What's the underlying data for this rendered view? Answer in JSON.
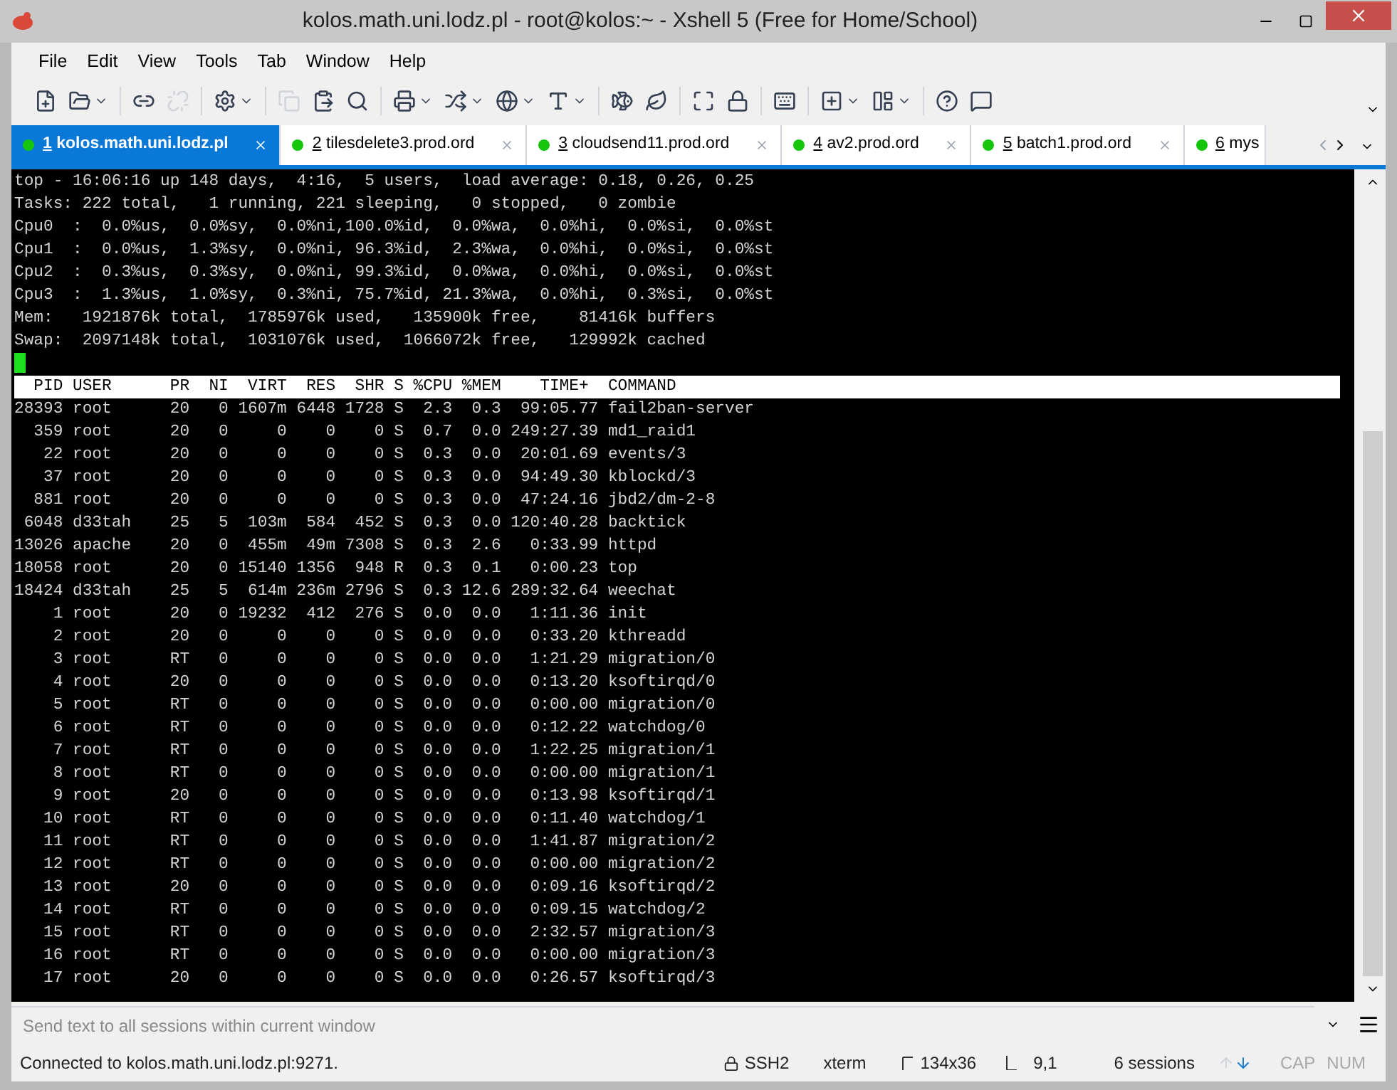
{
  "window": {
    "title": "kolos.math.uni.lodz.pl - root@kolos:~ - Xshell 5 (Free for Home/School)"
  },
  "menu": [
    "File",
    "Edit",
    "View",
    "Tools",
    "Tab",
    "Window",
    "Help"
  ],
  "tabs": [
    {
      "number": "1",
      "label": " kolos.math.uni.lodz.pl",
      "selected": true,
      "closable": true
    },
    {
      "number": "2",
      "label": " tilesdelete3.prod.ord",
      "selected": false,
      "closable": true
    },
    {
      "number": "3",
      "label": " cloudsend11.prod.ord",
      "selected": false,
      "closable": true
    },
    {
      "number": "4",
      "label": " av2.prod.ord",
      "selected": false,
      "closable": true
    },
    {
      "number": "5",
      "label": " batch1.prod.ord",
      "selected": false,
      "closable": true
    },
    {
      "number": "6",
      "label": " mys",
      "selected": false,
      "closable": false
    }
  ],
  "terminal": {
    "summary_lines": [
      "top - 16:06:16 up 148 days,  4:16,  5 users,  load average: 0.18, 0.26, 0.25",
      "Tasks: 222 total,   1 running, 221 sleeping,   0 stopped,   0 zombie",
      "Cpu0  :  0.0%us,  0.0%sy,  0.0%ni,100.0%id,  0.0%wa,  0.0%hi,  0.0%si,  0.0%st",
      "Cpu1  :  0.0%us,  1.3%sy,  0.0%ni, 96.3%id,  2.3%wa,  0.0%hi,  0.0%si,  0.0%st",
      "Cpu2  :  0.3%us,  0.3%sy,  0.0%ni, 99.3%id,  0.0%wa,  0.0%hi,  0.0%si,  0.0%st",
      "Cpu3  :  1.3%us,  1.0%sy,  0.3%ni, 75.7%id, 21.3%wa,  0.0%hi,  0.3%si,  0.0%st",
      "Mem:   1921876k total,  1785976k used,   135900k free,    81416k buffers",
      "Swap:  2097148k total,  1031076k used,  1066072k free,   129992k cached"
    ],
    "table_header": "  PID USER      PR  NI  VIRT  RES  SHR S %CPU %MEM    TIME+  COMMAND",
    "rows": [
      "28393 root      20   0 1607m 6448 1728 S  2.3  0.3  99:05.77 fail2ban-server",
      "  359 root      20   0     0    0    0 S  0.7  0.0 249:27.39 md1_raid1",
      "   22 root      20   0     0    0    0 S  0.3  0.0  20:01.69 events/3",
      "   37 root      20   0     0    0    0 S  0.3  0.0  94:49.30 kblockd/3",
      "  881 root      20   0     0    0    0 S  0.3  0.0  47:24.16 jbd2/dm-2-8",
      " 6048 d33tah    25   5  103m  584  452 S  0.3  0.0 120:40.28 backtick",
      "13026 apache    20   0  455m  49m 7308 S  0.3  2.6   0:33.99 httpd",
      "18058 root      20   0 15140 1356  948 R  0.3  0.1   0:00.23 top",
      "18424 d33tah    25   5  614m 236m 2796 S  0.3 12.6 289:32.64 weechat",
      "    1 root      20   0 19232  412  276 S  0.0  0.0   1:11.36 init",
      "    2 root      20   0     0    0    0 S  0.0  0.0   0:33.20 kthreadd",
      "    3 root      RT   0     0    0    0 S  0.0  0.0   1:21.29 migration/0",
      "    4 root      20   0     0    0    0 S  0.0  0.0   0:13.20 ksoftirqd/0",
      "    5 root      RT   0     0    0    0 S  0.0  0.0   0:00.00 migration/0",
      "    6 root      RT   0     0    0    0 S  0.0  0.0   0:12.22 watchdog/0",
      "    7 root      RT   0     0    0    0 S  0.0  0.0   1:22.25 migration/1",
      "    8 root      RT   0     0    0    0 S  0.0  0.0   0:00.00 migration/1",
      "    9 root      20   0     0    0    0 S  0.0  0.0   0:13.98 ksoftirqd/1",
      "   10 root      RT   0     0    0    0 S  0.0  0.0   0:11.40 watchdog/1",
      "   11 root      RT   0     0    0    0 S  0.0  0.0   1:41.87 migration/2",
      "   12 root      RT   0     0    0    0 S  0.0  0.0   0:00.00 migration/2",
      "   13 root      20   0     0    0    0 S  0.0  0.0   0:09.16 ksoftirqd/2",
      "   14 root      RT   0     0    0    0 S  0.0  0.0   0:09.15 watchdog/2",
      "   15 root      RT   0     0    0    0 S  0.0  0.0   2:32.57 migration/3",
      "   16 root      RT   0     0    0    0 S  0.0  0.0   0:00.00 migration/3",
      "   17 root      20   0     0    0    0 S  0.0  0.0   0:26.57 ksoftirqd/3"
    ]
  },
  "send_bar": {
    "placeholder": "Send text to all sessions within current window"
  },
  "status_bar": {
    "connection": "Connected to kolos.math.uni.lodz.pl:9271.",
    "protocol": "SSH2",
    "terminal_type": "xterm",
    "size": "134x36",
    "cursor": "9,1",
    "sessions": "6 sessions",
    "indicators": [
      {
        "label": "CAP",
        "on": false
      },
      {
        "label": "NUM",
        "on": false
      }
    ]
  }
}
